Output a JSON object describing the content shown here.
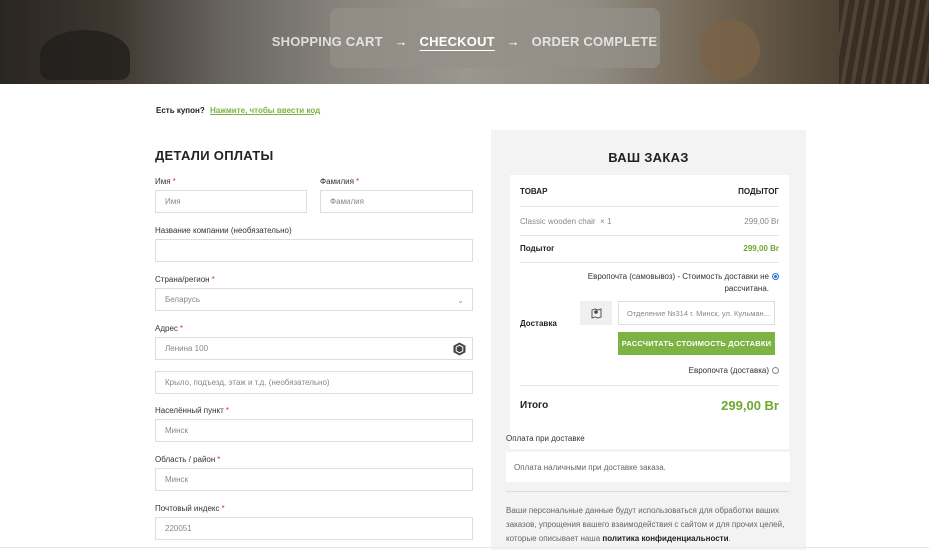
{
  "breadcrumb": {
    "step1": "SHOPPING CART",
    "arrow": "→",
    "step2": "CHECKOUT",
    "step3": "ORDER COMPLETE"
  },
  "coupon": {
    "question": "Есть купон?",
    "link": "Нажмите, чтобы ввести код"
  },
  "billing": {
    "title": "ДЕТАЛИ ОПЛАТЫ",
    "required_mark": "*",
    "first_name": {
      "label": "Имя",
      "placeholder": "Имя"
    },
    "last_name": {
      "label": "Фамилия",
      "placeholder": "Фамилия"
    },
    "company": {
      "label": "Название компании (необязательно)",
      "value": ""
    },
    "country": {
      "label": "Страна/регион",
      "value": "Беларусь"
    },
    "address": {
      "label": "Адрес",
      "value": "Ленина 100",
      "line2_placeholder": "Крыло, подъезд, этаж и т.д. (необязательно)"
    },
    "city": {
      "label": "Населённый пункт",
      "value": "Минск"
    },
    "region": {
      "label": "Область / район",
      "value": "Минск"
    },
    "postcode": {
      "label": "Почтовый индекс",
      "value": "220051"
    }
  },
  "order": {
    "title": "ВАШ ЗАКАЗ",
    "col_product": "ТОВАР",
    "col_subtotal": "ПОДЫТОГ",
    "item_name": "Classic wooden chair",
    "item_qty": "× 1",
    "item_price": "299,00 Br",
    "subtotal_label": "Подытог",
    "subtotal_value": "299,00 Br",
    "shipping_label": "Доставка",
    "shipping_option1_line1": "Европочта (самовывоз) - Стоимость доставки не",
    "shipping_option1_line2": "рассчитана.",
    "branch_select": "Отделение №314 г. Минск, ул. Кульман...",
    "calc_button": "РАССЧИТАТЬ СТОИМОСТЬ ДОСТАВКИ",
    "shipping_option2": "Европочта (доставка)",
    "total_label": "Итого",
    "total_value": "299,00 Br"
  },
  "payment": {
    "method": "Оплата при доставке",
    "description": "Оплата наличными при доставке заказа."
  },
  "privacy": {
    "text": "Ваши персональные данные будут использоваться для обработки ваших заказов, упрощения вашего взаимодействия с сайтом и для прочих целей, которые описывает наша",
    "link": "политика конфиденциальности",
    "end": "."
  },
  "colors": {
    "accent_green": "#7cb342",
    "price_green": "#6fa82e",
    "required_red": "#dd3333",
    "radio_blue": "#2a6fd6"
  }
}
